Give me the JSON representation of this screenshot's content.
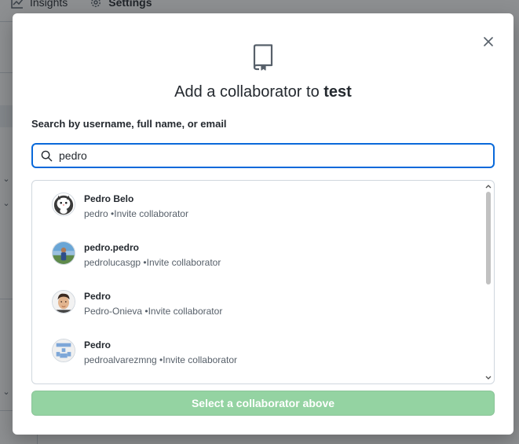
{
  "background": {
    "tabs": [
      {
        "label": "Insights",
        "icon": "graph-icon"
      },
      {
        "label": "Settings",
        "icon": "gear-icon"
      }
    ]
  },
  "modal": {
    "title_prefix": "Add a collaborator to",
    "repo_name": "test",
    "search_label": "Search by username, full name, or email",
    "search_value": "pedro",
    "results": [
      {
        "name": "Pedro Belo",
        "username": "pedro",
        "action": "Invite collaborator",
        "avatar": "cat-avatar"
      },
      {
        "name": "pedro.pedro",
        "username": "pedrolucasgp",
        "action": "Invite collaborator",
        "avatar": "photo-avatar"
      },
      {
        "name": "Pedro",
        "username": "Pedro-Onieva",
        "action": "Invite collaborator",
        "avatar": "face-avatar"
      },
      {
        "name": "Pedro",
        "username": "pedroalvarezmng",
        "action": "Invite collaborator",
        "avatar": "identicon-avatar"
      }
    ],
    "submit_label": "Select a collaborator above"
  },
  "colors": {
    "accent": "#0969da",
    "button_disabled": "#94d3a2"
  }
}
